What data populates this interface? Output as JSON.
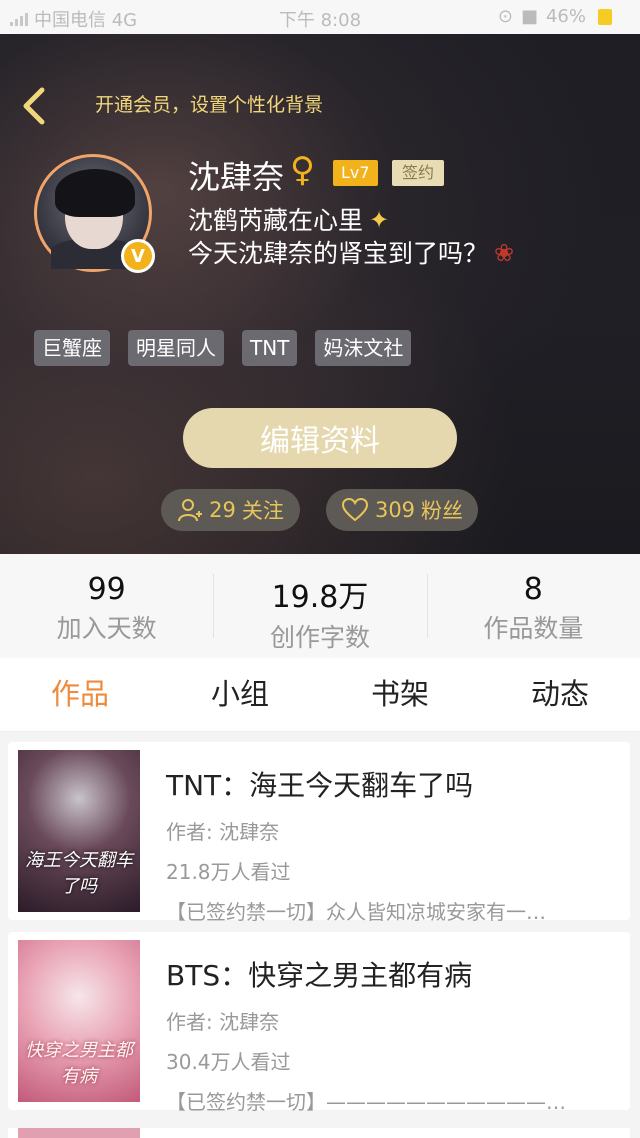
{
  "status_bar": {
    "carrier": "中国电信 4G",
    "time": "下午 8:08",
    "battery": "46%"
  },
  "header": {
    "vip_banner": "开通会员，设置个性化背景",
    "username": "沈肆奈",
    "gender": "♀",
    "level": "Lv7",
    "signed": "签约",
    "bio_line1": "沈鹤芮藏在心里",
    "bio_line2": "今天沈肆奈的肾宝到了吗？",
    "tags": [
      "巨蟹座",
      "明星同人",
      "TNT",
      "妈沫文社"
    ],
    "edit_button": "编辑资料",
    "follow_count": "29",
    "follow_label": "关注",
    "fans_count": "309",
    "fans_label": "粉丝"
  },
  "stats": [
    {
      "value": "99",
      "label": "加入天数"
    },
    {
      "value": "19.8万",
      "label": "创作字数"
    },
    {
      "value": "8",
      "label": "作品数量"
    }
  ],
  "tabs": [
    {
      "label": "作品",
      "active": true
    },
    {
      "label": "小组",
      "active": false
    },
    {
      "label": "书架",
      "active": false
    },
    {
      "label": "动态",
      "active": false
    }
  ],
  "works": [
    {
      "title": "TNT：海王今天翻车了吗",
      "author": "作者: 沈肆奈",
      "views": "21.8万人看过",
      "desc": "【已签约禁一切】众人皆知凉城安家有一…",
      "cover_text": "海王今天翻车了吗"
    },
    {
      "title": "BTS：快穿之男主都有病",
      "author": "作者: 沈肆奈",
      "views": "30.4万人看过",
      "desc": "【已签约禁一切】———————————…",
      "cover_text": "快穿之男主都有病"
    }
  ],
  "colors": {
    "accent": "#f08a3c",
    "gold": "#f2b21c",
    "edit_button": "#e5d7ae"
  }
}
